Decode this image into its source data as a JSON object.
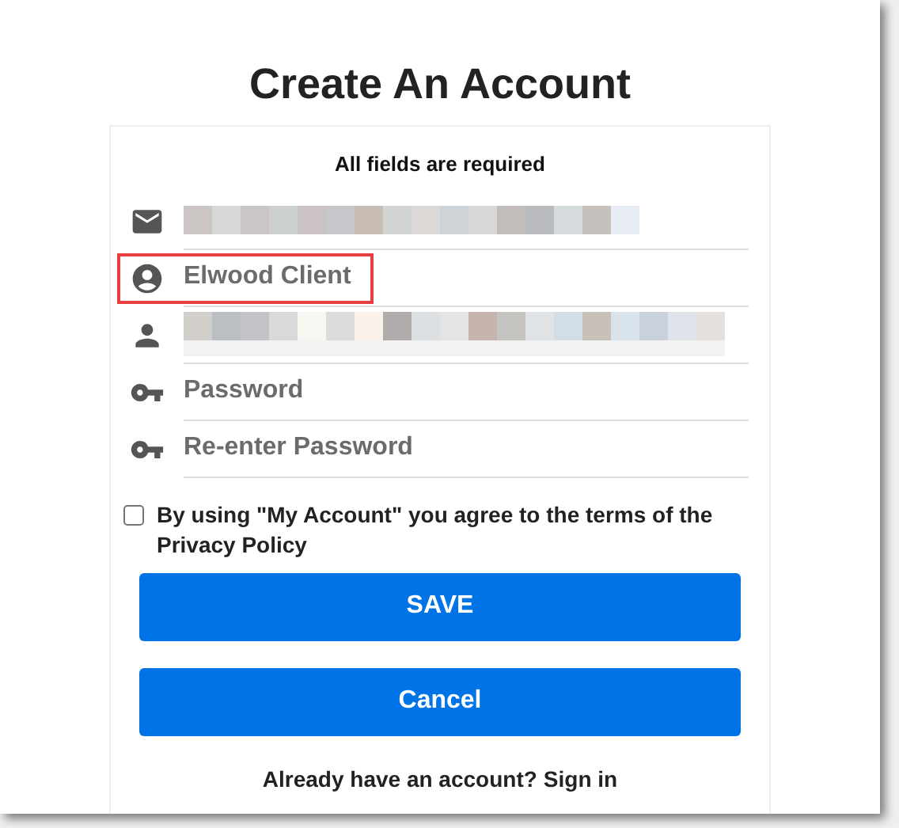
{
  "title": "Create An Account",
  "note": "All fields are required",
  "fields": [
    {
      "kind": "email",
      "highlighted": false
    },
    {
      "kind": "name",
      "placeholder": "Elwood Client",
      "highlighted": true
    },
    {
      "kind": "user",
      "highlighted": false
    },
    {
      "kind": "password",
      "placeholder": "Password",
      "highlighted": false
    },
    {
      "kind": "password",
      "placeholder": "Re-enter Password",
      "highlighted": false
    }
  ],
  "agreement": {
    "checked": false,
    "text": "By using \"My Account\" you agree to the terms of the Privacy Policy"
  },
  "buttons": [
    {
      "label": "SAVE"
    },
    {
      "label": "Cancel"
    }
  ],
  "footer": {
    "text": "Already have an account?",
    "link": "Sign in"
  }
}
